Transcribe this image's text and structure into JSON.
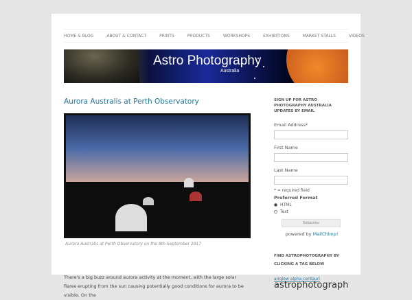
{
  "nav": [
    "Home & Blog",
    "About & Contact",
    "Prints",
    "Products",
    "Workshops",
    "Exhibitions",
    "Market Stalls",
    "Videos"
  ],
  "banner": {
    "title": "Astro Photography",
    "subtitle": "Australia"
  },
  "post": {
    "title": "Aurora Australis at Perth Observatory",
    "caption": "Aurora Australis at Perth Observatory on the 8th September 2017",
    "body": "There's a big buzz around aurora activity at the moment, with the large solar flares erupting from the sun causing potentially good conditions for aurora to be visible. On the"
  },
  "signup": {
    "heading": "Sign up for Astro Photography Australia updates by email",
    "email_label": "Email Address*",
    "first_label": "First Name",
    "last_label": "Last Name",
    "required_note": "* = required field",
    "format_label": "Preferred Format",
    "options": [
      "HTML",
      "Text"
    ],
    "subscribe": "Subscribe",
    "powered": "powered by",
    "mailchimp": "MailChimp!"
  },
  "tags": {
    "heading": "Find astrophotography by clicking a tag below",
    "small_tags": "airglow alpha centauri",
    "big_tag": "astrophotograph"
  }
}
